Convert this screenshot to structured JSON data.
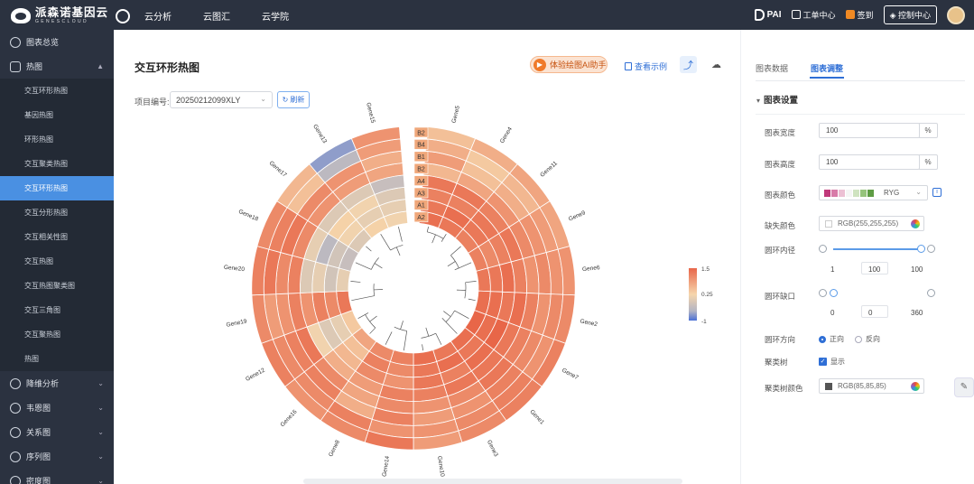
{
  "topbar": {
    "logo_text": "派森诺基因云",
    "logo_sub": "GENESCLOUD",
    "nav": [
      "云分析",
      "云图汇",
      "云学院"
    ],
    "pai": "PAI",
    "ticket": "工单中心",
    "sign": "签到",
    "console": "控制中心"
  },
  "sidebar": {
    "items": [
      {
        "label": "图表总览",
        "icon": "grid-icon",
        "chevron": ""
      },
      {
        "label": "热图",
        "icon": "heatmap-icon",
        "chevron": "▲"
      }
    ],
    "subitems": [
      {
        "label": "交互环形热图",
        "active": false
      },
      {
        "label": "基因热图",
        "active": false
      },
      {
        "label": "环形热图",
        "active": false
      },
      {
        "label": "交互聚类热图",
        "active": false
      },
      {
        "label": "交互环形热图",
        "active": true
      },
      {
        "label": "交互分形热图",
        "active": false
      },
      {
        "label": "交互相关性图",
        "active": false
      },
      {
        "label": "交互热图",
        "active": false
      },
      {
        "label": "交互热图聚类图",
        "active": false
      },
      {
        "label": "交互三角图",
        "active": false
      },
      {
        "label": "交互聚热图",
        "active": false
      },
      {
        "label": "热图",
        "active": false
      }
    ],
    "groups": [
      {
        "label": "降维分析",
        "icon": "dimension-icon"
      },
      {
        "label": "韦恩图",
        "icon": "venn-icon"
      },
      {
        "label": "关系图",
        "icon": "relation-icon"
      },
      {
        "label": "序列图",
        "icon": "sequence-icon"
      },
      {
        "label": "密度图",
        "icon": "density-icon"
      }
    ]
  },
  "main": {
    "title": "交互环形热图",
    "ai_button": "体验绘图AI助手",
    "view_example": "查看示例",
    "project_label": "项目编号:",
    "project_value": "20250212099XLY",
    "refresh": "刷新"
  },
  "chart_data": {
    "type": "heatmap",
    "layout": "circular",
    "rows": [
      "A2",
      "A1",
      "A3",
      "A4",
      "B2",
      "B1",
      "B4",
      "B2"
    ],
    "genes": [
      "Gene5",
      "Gene4",
      "Gene11",
      "Gene9",
      "Gene6",
      "Gene2",
      "Gene7",
      "Gene1",
      "Gene3",
      "Gene10",
      "Gene14",
      "Gene8",
      "Gene16",
      "Gene12",
      "Gene19",
      "Gene20",
      "Gene18",
      "Gene17",
      "Gene13",
      "Gene15"
    ],
    "legend": {
      "max": "1.5",
      "mid": "0.25",
      "min": "-1"
    },
    "values": [
      [
        1.4,
        1.3,
        1.2,
        1.2,
        1.3,
        1.4,
        1.5,
        1.4,
        1.3,
        1.4,
        1.2,
        1.1,
        0.8,
        0.4,
        1.3,
        0.1,
        -0.2,
        0.0,
        0.3,
        0.2
      ],
      [
        1.3,
        1.4,
        1.3,
        1.1,
        1.3,
        1.4,
        1.4,
        1.3,
        1.4,
        1.3,
        1.1,
        1.2,
        0.5,
        0.1,
        1.1,
        -0.1,
        -0.1,
        0.2,
        0.1,
        0.1
      ],
      [
        1.2,
        1.2,
        1.3,
        1.2,
        1.4,
        1.3,
        1.5,
        1.4,
        1.2,
        1.3,
        1.0,
        1.1,
        0.6,
        0.0,
        1.2,
        0.1,
        -0.3,
        0.3,
        0.2,
        0.0
      ],
      [
        1.3,
        1.3,
        1.2,
        1.3,
        1.2,
        1.4,
        1.3,
        1.3,
        1.3,
        1.2,
        1.2,
        0.9,
        0.7,
        0.2,
        1.0,
        0.0,
        0.1,
        0.0,
        0.0,
        -0.2
      ],
      [
        0.6,
        0.8,
        1.0,
        1.1,
        1.0,
        1.2,
        1.2,
        1.3,
        1.1,
        1.0,
        1.1,
        0.8,
        1.1,
        1.3,
        1.2,
        1.2,
        1.1,
        1.0,
        0.9,
        0.8
      ],
      [
        0.9,
        0.5,
        0.7,
        1.0,
        1.1,
        1.0,
        1.1,
        1.2,
        1.0,
        0.9,
        1.2,
        0.7,
        1.2,
        1.2,
        1.0,
        1.1,
        1.3,
        1.1,
        1.0,
        0.7
      ],
      [
        0.7,
        0.4,
        0.6,
        0.9,
        1.0,
        1.1,
        1.0,
        1.2,
        1.1,
        1.0,
        1.0,
        1.2,
        1.1,
        1.1,
        0.9,
        1.3,
        1.2,
        0.5,
        -0.3,
        0.9
      ],
      [
        0.5,
        0.7,
        0.8,
        0.8,
        1.0,
        1.1,
        1.2,
        1.2,
        1.1,
        0.9,
        1.3,
        1.1,
        1.0,
        1.2,
        1.1,
        1.2,
        1.1,
        0.6,
        -0.6,
        1.0
      ]
    ]
  },
  "panel": {
    "tabs": [
      "图表数据",
      "图表调整"
    ],
    "section": "图表设置",
    "width_label": "图表宽度",
    "width_value": "100",
    "width_unit": "%",
    "height_label": "图表高度",
    "height_value": "100",
    "height_unit": "%",
    "color_label": "图表颜色",
    "palette_name": "RYG",
    "bg_label": "缺失颜色",
    "bg_value": "RGB(255,255,255)",
    "inner_label": "圆环内径",
    "inner_min": "1",
    "inner_value": "100",
    "inner_max": "100",
    "gap_label": "圆环缺口",
    "gap_min": "0",
    "gap_value": "0",
    "gap_max": "360",
    "dir_label": "圆环方向",
    "dir_opt1": "正向",
    "dir_opt2": "反向",
    "cluster_label": "聚类树",
    "cluster_opt": "显示",
    "cluster_color_label": "聚类树颜色",
    "cluster_color_value": "RGB(85,85,85)",
    "palette": [
      "#c0397a",
      "#d87ba8",
      "#ecc0d4",
      "#f5f5f5",
      "#cfe3c0",
      "#96c47c",
      "#5e9c44"
    ],
    "accent": "#2f6fd6"
  }
}
